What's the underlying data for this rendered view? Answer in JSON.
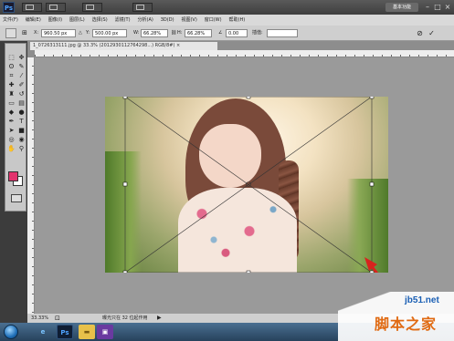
{
  "app": {
    "logo_text": "Ps",
    "workspace_label": "基本功能"
  },
  "window_controls": [
    "–",
    "□",
    "×"
  ],
  "menu": [
    "文件(F)",
    "编辑(E)",
    "图像(I)",
    "图层(L)",
    "选择(S)",
    "滤镜(T)",
    "分析(A)",
    "3D(D)",
    "视图(V)",
    "窗口(W)",
    "帮助(H)"
  ],
  "options_bar": {
    "x_label": "X:",
    "x_value": "960.50 px",
    "y_label": "Y:",
    "y_value": "500.00 px",
    "w_label": "W:",
    "w_value": "66.28%",
    "h_label": "H:",
    "h_value": "66.28%",
    "angle_value": "0.00",
    "interp_label": "插值:",
    "commit_icon": "✓",
    "cancel_icon": "⊘"
  },
  "document": {
    "tab_title": "1_0726313111.jpg @ 33.3% (2012930112764298...) RGB/8#) ×"
  },
  "status": {
    "zoom": "33.33%",
    "info": "曝光只在 32 位起作用"
  },
  "taskbar": {
    "ps_label": "Ps"
  },
  "watermark": {
    "url": "jb51.net",
    "text": "脚本之家"
  },
  "colors": {
    "foreground": "#e3336e",
    "background": "#ffffff",
    "arrow": "#d8231e"
  }
}
